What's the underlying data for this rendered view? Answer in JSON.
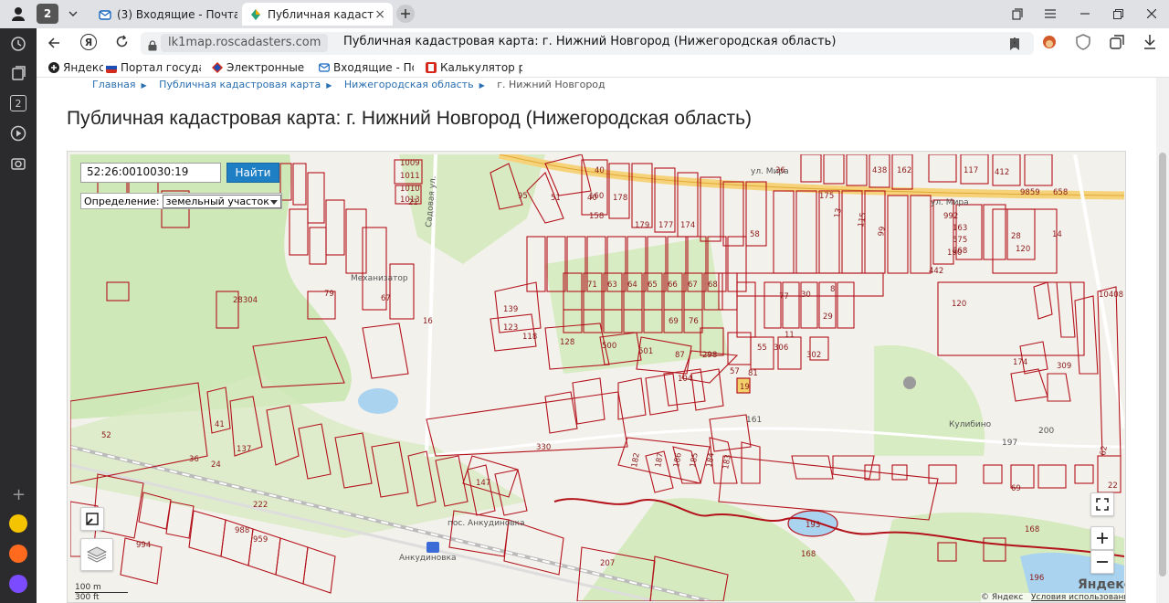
{
  "browser": {
    "tab_count": "2",
    "tabs": [
      {
        "title": "(3) Входящие - Почта Ма",
        "active": false
      },
      {
        "title": "Публичная кадастрова",
        "active": true
      }
    ],
    "url_host": "lk1map.roscadasters.com",
    "page_title_in_bar": "Публичная кадастровая карта: г. Нижний Новгород (Нижегородская область)",
    "bookmarks": [
      "Яндекс",
      "Портал государст",
      "Электронные сер",
      "Входящие - Почта",
      "Калькулятор рас"
    ],
    "sidebar_badge": "2"
  },
  "breadcrumbs": [
    "Главная",
    "Публичная кадастровая карта",
    "Нижегородская область",
    "г. Нижний Новгород"
  ],
  "heading": "Публичная кадастровая карта: г. Нижний Новгород (Нижегородская область)",
  "map": {
    "search_value": "52:26:0010030:19",
    "find_button": "Найти",
    "definition_label": "Определение:",
    "definition_value": "земельный участок",
    "scale_top": "100 m",
    "scale_bottom": "300 ft",
    "copyright": "© Яндекс",
    "terms_link": "Условия использования",
    "logo": "Яндекс",
    "place_labels": [
      "Механизатор",
      "пос. Анкудиновка",
      "Анкудиновка",
      "ул. Мира",
      "ул. Мира",
      "Садовая ул.",
      "Кулибино"
    ],
    "parcel_labels": [
      "1009",
      "1011",
      "1010",
      "1013",
      "21",
      "95",
      "51",
      "40",
      "160",
      "158",
      "178",
      "179",
      "177",
      "174",
      "175",
      "58",
      "36",
      "438",
      "162",
      "117",
      "412",
      "9859",
      "658",
      "120",
      "120",
      "10408",
      "28304",
      "79",
      "67",
      "139",
      "123",
      "118",
      "128",
      "500",
      "501",
      "87",
      "104",
      "298",
      "57",
      "81",
      "19",
      "161",
      "174",
      "309",
      "330",
      "147",
      "222",
      "137",
      "24",
      "36",
      "41",
      "52",
      "994",
      "988",
      "959",
      "207",
      "193",
      "168",
      "168",
      "196",
      "182",
      "187",
      "186",
      "185",
      "184",
      "183",
      "197",
      "200",
      "69",
      "62",
      "22",
      "14",
      "16",
      "40",
      "71",
      "63",
      "64",
      "65",
      "66",
      "67",
      "68",
      "69",
      "76",
      "77",
      "30",
      "29",
      "8",
      "11",
      "302",
      "55",
      "306",
      "28",
      "13",
      "115",
      "99",
      "190",
      "442",
      "992",
      "163",
      "575",
      "268",
      "267",
      "265"
    ]
  },
  "colors": {
    "parcel_stroke": "#b3121b",
    "map_bg": "#f3f1ec",
    "forest": "#cfe8b8",
    "water": "#aad3f0",
    "road": "#f6d37b",
    "accent": "#1e7fc4"
  }
}
